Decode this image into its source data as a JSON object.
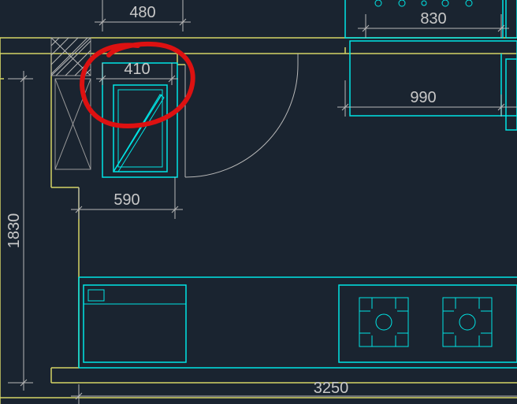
{
  "dimensions": {
    "d480": "480",
    "d410": "410",
    "d590": "590",
    "d1830": "1830",
    "d830": "830",
    "d990": "990",
    "d3250": "3250"
  }
}
